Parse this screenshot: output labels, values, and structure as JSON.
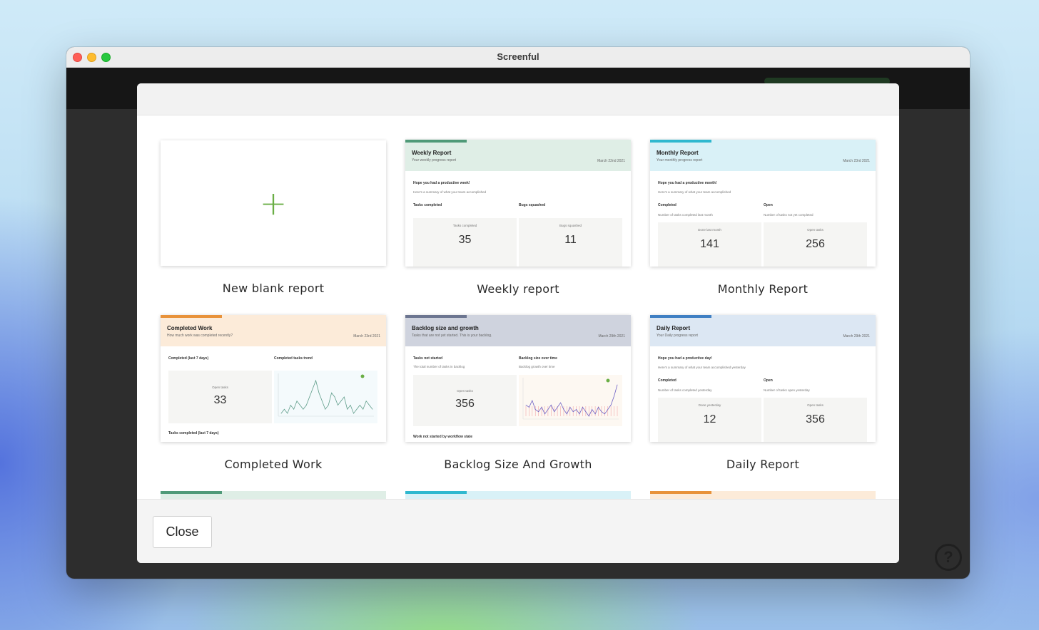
{
  "window": {
    "title": "Screenful"
  },
  "help": {
    "glyph": "?"
  },
  "footer": {
    "close_label": "Close"
  },
  "blank": {
    "label": "New blank report",
    "icon": "plus-icon",
    "glyph": "+"
  },
  "cards": [
    {
      "id": "weekly",
      "label": "Weekly report",
      "accent": "#4f9a78",
      "header_bg": "#dfeee6",
      "title": "Weekly Report",
      "subtitle": "Your weekly progress report",
      "date": "March 22nd 2021",
      "greeting": "Hope you had a productive week!",
      "summary": "Here's a summary of what your team accomplished",
      "left_heading": "Tasks completed",
      "left_desc": "",
      "right_heading": "Bugs squashed",
      "right_desc": "",
      "left_tile_label": "Tasks completed",
      "left_value": "35",
      "right_tile_label": "Bugs squashed",
      "right_value": "11"
    },
    {
      "id": "monthly",
      "label": "Monthly Report",
      "accent": "#2fb8cf",
      "header_bg": "#d9f1f7",
      "title": "Monthly Report",
      "subtitle": "Your monthly progress report",
      "date": "March 23rd 2021",
      "greeting": "Hope you had a productive month!",
      "summary": "Here's a summary of what your team accomplished",
      "left_heading": "Completed",
      "left_desc": "Number of tasks completed last month",
      "right_heading": "Open",
      "right_desc": "Number of tasks not yet completed",
      "left_tile_label": "Done last month",
      "left_value": "141",
      "right_tile_label": "Open tasks",
      "right_value": "256"
    },
    {
      "id": "completed",
      "label": "Completed Work",
      "accent": "#e8923a",
      "header_bg": "#fcebd9",
      "title": "Completed Work",
      "subtitle": "How much work was completed recently?",
      "date": "March 23rd 2021",
      "left_heading": "Completed (last 7 days)",
      "right_heading": "Completed tasks trend",
      "left_tile_label": "Open tasks",
      "left_value": "33",
      "bottom_heading": "Tasks completed (last 7 days)"
    },
    {
      "id": "backlog",
      "label": "Backlog Size And Growth",
      "accent": "#6c7590",
      "header_bg": "#cfd3de",
      "title": "Backlog size and growth",
      "subtitle": "Tasks that are not yet started. This is your backlog.",
      "date": "March 29th 2021",
      "left_heading": "Tasks not started",
      "left_desc": "The total number of tasks in backlog",
      "right_heading": "Backlog size over time",
      "right_desc": "Backlog growth over time",
      "left_tile_label": "Open tasks",
      "left_value": "356",
      "bottom_heading": "Work not started by workflow state"
    },
    {
      "id": "daily",
      "label": "Daily Report",
      "accent": "#3f7fc3",
      "header_bg": "#dce7f3",
      "title": "Daily Report",
      "subtitle": "Your Daily progress report",
      "date": "March 29th 2021",
      "greeting": "Hope you had a productive day!",
      "summary": "Here's a summary of what your team accomplished yesterday",
      "left_heading": "Completed",
      "left_desc": "Number of tasks completed yesterday",
      "right_heading": "Open",
      "right_desc": "Number of tasks open yesterday",
      "left_tile_label": "Done yesterday",
      "left_value": "12",
      "right_tile_label": "Open tasks",
      "right_value": "356"
    }
  ],
  "peek_cards": [
    {
      "accent": "#4f9a78",
      "header_bg": "#dfeee6"
    },
    {
      "accent": "#2fb8cf",
      "header_bg": "#d9f1f7"
    },
    {
      "accent": "#e8923a",
      "header_bg": "#fcebd9"
    }
  ],
  "chart_data": [
    {
      "type": "line",
      "card": "completed",
      "title": "",
      "values": [
        3,
        4,
        3,
        5,
        4,
        6,
        5,
        4,
        5,
        7,
        9,
        11,
        8,
        6,
        4,
        5,
        8,
        7,
        5,
        6,
        7,
        4,
        5,
        3,
        4,
        5,
        4,
        6,
        5,
        4
      ]
    },
    {
      "type": "line",
      "card": "backlog",
      "title": "",
      "values": [
        356,
        355,
        358,
        354,
        353,
        355,
        352,
        354,
        356,
        353,
        355,
        357,
        354,
        352,
        355,
        353,
        354,
        352,
        355,
        353,
        351,
        354,
        352,
        355,
        353,
        352,
        354,
        356,
        360,
        365
      ]
    }
  ]
}
